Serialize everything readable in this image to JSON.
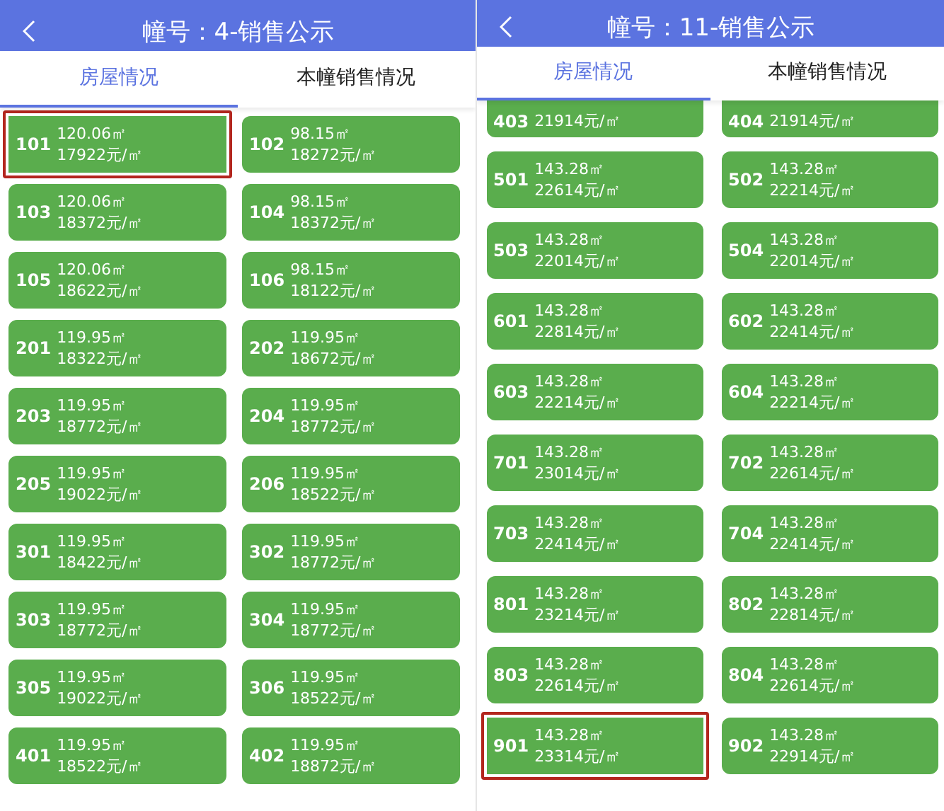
{
  "panels": [
    {
      "title": "幢号：4-销售公示",
      "tabs": [
        {
          "label": "房屋情况",
          "selected": true
        },
        {
          "label": "本幢销售情况",
          "selected": false
        }
      ],
      "units": [
        {
          "number": "101",
          "area": "120.06㎡",
          "price": "17922元/㎡",
          "selected": true
        },
        {
          "number": "102",
          "area": "98.15㎡",
          "price": "18272元/㎡",
          "selected": false
        },
        {
          "number": "103",
          "area": "120.06㎡",
          "price": "18372元/㎡",
          "selected": false
        },
        {
          "number": "104",
          "area": "98.15㎡",
          "price": "18372元/㎡",
          "selected": false
        },
        {
          "number": "105",
          "area": "120.06㎡",
          "price": "18622元/㎡",
          "selected": false
        },
        {
          "number": "106",
          "area": "98.15㎡",
          "price": "18122元/㎡",
          "selected": false
        },
        {
          "number": "201",
          "area": "119.95㎡",
          "price": "18322元/㎡",
          "selected": false
        },
        {
          "number": "202",
          "area": "119.95㎡",
          "price": "18672元/㎡",
          "selected": false
        },
        {
          "number": "203",
          "area": "119.95㎡",
          "price": "18772元/㎡",
          "selected": false
        },
        {
          "number": "204",
          "area": "119.95㎡",
          "price": "18772元/㎡",
          "selected": false
        },
        {
          "number": "205",
          "area": "119.95㎡",
          "price": "19022元/㎡",
          "selected": false
        },
        {
          "number": "206",
          "area": "119.95㎡",
          "price": "18522元/㎡",
          "selected": false
        },
        {
          "number": "301",
          "area": "119.95㎡",
          "price": "18422元/㎡",
          "selected": false
        },
        {
          "number": "302",
          "area": "119.95㎡",
          "price": "18772元/㎡",
          "selected": false
        },
        {
          "number": "303",
          "area": "119.95㎡",
          "price": "18772元/㎡",
          "selected": false
        },
        {
          "number": "304",
          "area": "119.95㎡",
          "price": "18772元/㎡",
          "selected": false
        },
        {
          "number": "305",
          "area": "119.95㎡",
          "price": "19022元/㎡",
          "selected": false
        },
        {
          "number": "306",
          "area": "119.95㎡",
          "price": "18522元/㎡",
          "selected": false
        },
        {
          "number": "401",
          "area": "119.95㎡",
          "price": "18522元/㎡",
          "selected": false
        },
        {
          "number": "402",
          "area": "119.95㎡",
          "price": "18872元/㎡",
          "selected": false
        }
      ]
    },
    {
      "title": "幢号：11-销售公示",
      "tabs": [
        {
          "label": "房屋情况",
          "selected": true
        },
        {
          "label": "本幢销售情况",
          "selected": false
        }
      ],
      "units": [
        {
          "number": "403",
          "price": "21914元/㎡",
          "selected": false
        },
        {
          "number": "404",
          "price": "21914元/㎡",
          "selected": false
        },
        {
          "number": "501",
          "area": "143.28㎡",
          "price": "22614元/㎡",
          "selected": false
        },
        {
          "number": "502",
          "area": "143.28㎡",
          "price": "22214元/㎡",
          "selected": false
        },
        {
          "number": "503",
          "area": "143.28㎡",
          "price": "22014元/㎡",
          "selected": false
        },
        {
          "number": "504",
          "area": "143.28㎡",
          "price": "22014元/㎡",
          "selected": false
        },
        {
          "number": "601",
          "area": "143.28㎡",
          "price": "22814元/㎡",
          "selected": false
        },
        {
          "number": "602",
          "area": "143.28㎡",
          "price": "22414元/㎡",
          "selected": false
        },
        {
          "number": "603",
          "area": "143.28㎡",
          "price": "22214元/㎡",
          "selected": false
        },
        {
          "number": "604",
          "area": "143.28㎡",
          "price": "22214元/㎡",
          "selected": false
        },
        {
          "number": "701",
          "area": "143.28㎡",
          "price": "23014元/㎡",
          "selected": false
        },
        {
          "number": "702",
          "area": "143.28㎡",
          "price": "22614元/㎡",
          "selected": false
        },
        {
          "number": "703",
          "area": "143.28㎡",
          "price": "22414元/㎡",
          "selected": false
        },
        {
          "number": "704",
          "area": "143.28㎡",
          "price": "22414元/㎡",
          "selected": false
        },
        {
          "number": "801",
          "area": "143.28㎡",
          "price": "23214元/㎡",
          "selected": false
        },
        {
          "number": "802",
          "area": "143.28㎡",
          "price": "22814元/㎡",
          "selected": false
        },
        {
          "number": "803",
          "area": "143.28㎡",
          "price": "22614元/㎡",
          "selected": false
        },
        {
          "number": "804",
          "area": "143.28㎡",
          "price": "22614元/㎡",
          "selected": false
        },
        {
          "number": "901",
          "area": "143.28㎡",
          "price": "23314元/㎡",
          "selected": true
        },
        {
          "number": "902",
          "area": "143.28㎡",
          "price": "22914元/㎡",
          "selected": false
        }
      ]
    }
  ]
}
